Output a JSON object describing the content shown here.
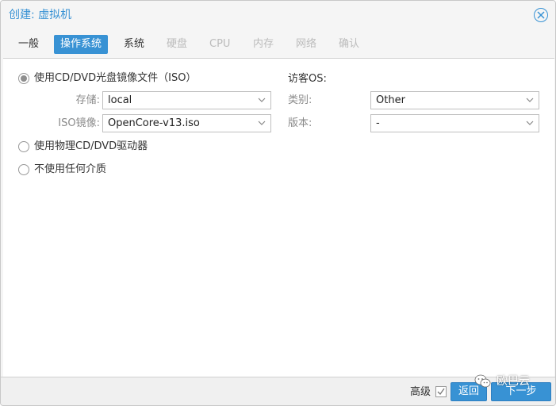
{
  "dialog": {
    "title": "创建: 虚拟机"
  },
  "tabs": [
    {
      "label": "一般",
      "state": "normal"
    },
    {
      "label": "操作系统",
      "state": "active"
    },
    {
      "label": "系统",
      "state": "normal"
    },
    {
      "label": "硬盘",
      "state": "disabled"
    },
    {
      "label": "CPU",
      "state": "disabled"
    },
    {
      "label": "内存",
      "state": "disabled"
    },
    {
      "label": "网络",
      "state": "disabled"
    },
    {
      "label": "确认",
      "state": "disabled"
    }
  ],
  "media": {
    "option_iso": "使用CD/DVD光盘镜像文件（ISO）",
    "storage_label": "存储:",
    "storage_value": "local",
    "iso_label": "ISO镜像:",
    "iso_value": "OpenCore-v13.iso",
    "option_physical": "使用物理CD/DVD驱动器",
    "option_none": "不使用任何介质"
  },
  "guest_os": {
    "title": "访客OS:",
    "type_label": "类别:",
    "type_value": "Other",
    "version_label": "版本:",
    "version_value": "-"
  },
  "footer": {
    "advanced_label": "高级",
    "back_label": "返回",
    "next_label": "下一步"
  },
  "watermark": {
    "text": "欧巴云"
  },
  "colors": {
    "accent": "#3892d4",
    "disabled_text": "#bbbbbb"
  }
}
